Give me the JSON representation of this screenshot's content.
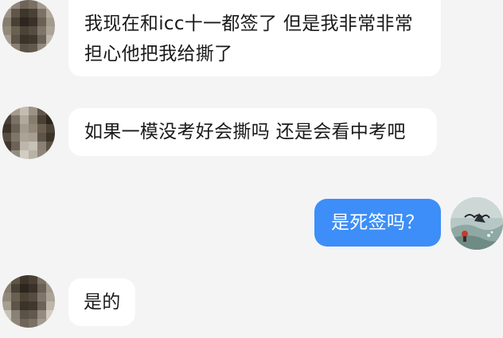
{
  "conversation": {
    "messages": [
      {
        "direction": "incoming",
        "avatar_icon": "pixelated-contact-avatar-icon",
        "lines": [
          "我现在和icc十一都签了 但是我非常非常",
          "担心他把我给撕了"
        ]
      },
      {
        "direction": "incoming",
        "avatar_icon": "pixelated-contact-avatar-icon",
        "lines": [
          "如果一模没考好会撕吗 还是会看中考吧"
        ]
      },
      {
        "direction": "outgoing",
        "avatar_icon": "user-avatar-icon",
        "lines": [
          "是死签吗？"
        ]
      },
      {
        "direction": "incoming",
        "avatar_icon": "pixelated-contact-avatar-icon",
        "lines": [
          "是的"
        ]
      }
    ]
  },
  "colors": {
    "background": "#f4f4f5",
    "incoming_bubble": "#ffffff",
    "outgoing_bubble": "#3d8ef8",
    "incoming_text": "#1a1a1a",
    "outgoing_text": "#ffffff"
  }
}
